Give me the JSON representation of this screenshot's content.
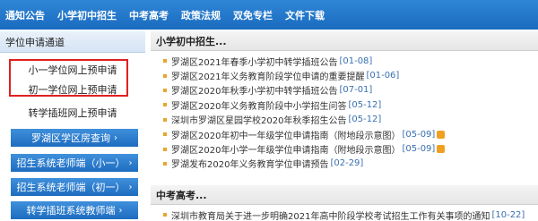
{
  "nav": {
    "items": [
      "通知公告",
      "小学初中招生",
      "中考高考",
      "政策法规",
      "双免专栏",
      "文件下载"
    ]
  },
  "left": {
    "heading": "学位申请通道",
    "primary_school_apply": "小一学位网上预申请",
    "junior_school_apply": "初一学位网上预申请",
    "transfer_apply": "转学插班网上预申请",
    "buttons": [
      "罗湖区学区房查询",
      "招生系统老师端（小一）",
      "招生系统老师端（初一）",
      "转学插班系统教师端"
    ]
  },
  "right": {
    "section1_title": "小学初中招生...",
    "news": [
      {
        "title": "罗湖区2021年春季小学初中转学插班公告",
        "date": "[01-08]"
      },
      {
        "title": "罗湖区2021年义务教育阶段学位申请的重要提醒",
        "date": "[01-06]"
      },
      {
        "title": "罗湖区2020年秋季小学初中转学插班公告",
        "date": "[07-01]"
      },
      {
        "title": "罗湖区2020年义务教育阶段中小学招生问答",
        "date": "[05-12]"
      },
      {
        "title": "深圳市罗湖区星园学校2020年秋季招生公告",
        "date": "[05-12]"
      },
      {
        "title": "罗湖区2020年初中一年级学位申请指南（附地段示意图）",
        "date": "[05-09]",
        "badge": "hot"
      },
      {
        "title": "罗湖区2020年小学一年级学位申请指南（附地段示意图）",
        "date": "[05-09]",
        "badge": "hot"
      },
      {
        "title": "罗湖发布2020年义务教育学位申请预告",
        "date": "[02-29]"
      }
    ],
    "section2_title": "中考高考...",
    "news2": [
      {
        "title": "深圳市教育局关于进一步明确2021年高中阶段学校考试招生工作有关事项的通知",
        "date": "[10-22]"
      }
    ]
  },
  "colors": {
    "nav_bg": "#1f72c6",
    "button_bg": "#2a7ccd",
    "highlight_border": "#e02020",
    "date_color": "#3a6fb0"
  }
}
